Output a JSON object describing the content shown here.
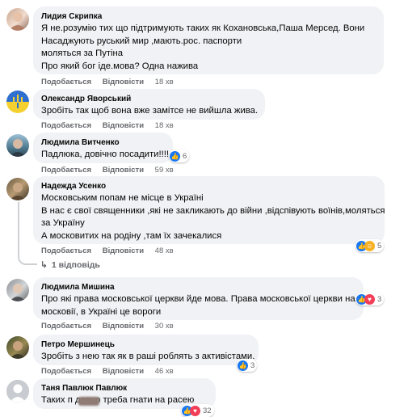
{
  "ui": {
    "like_label": "Подобається",
    "reply_label": "Відповісти",
    "replies_link": "1 відповідь",
    "colors": {
      "bubble": "#f0f2f5",
      "meta": "#65676b",
      "like": "#1877f2",
      "love": "#f33e58",
      "haha": "#f7b125"
    }
  },
  "comments": [
    {
      "author": "Лидия Скрипка",
      "lines": [
        "Я не.розумію тих що підтримують таких як Кохановська,Паша Мерсед. Вони",
        "Насаджують руський мир ,мають.рос. паспорти",
        "моляться за Путіна",
        "Про який бог іде.мова? Одна нажива"
      ],
      "time": "18 хв"
    },
    {
      "author": "Олександр Яворський",
      "lines": [
        "Зробіть так щоб вона вже замітсе не вийшла жива."
      ],
      "time": "18 хв"
    },
    {
      "author": "Людмила Витченко",
      "lines": [
        "Падлюка, довічно посадити!!!!"
      ],
      "time": "59 хв",
      "reactions": {
        "icons": [
          "like-icon"
        ],
        "count": "6"
      }
    },
    {
      "author": "Надежда Усенко",
      "lines": [
        "Московським попам не місце в Україні",
        "В нас є свої священники ,які не закликають до війни ,відспівують воїнів,моляться",
        "за Україну",
        "А московитих на родіну ,там їх зачекалися"
      ],
      "time": "48 хв",
      "reactions": {
        "icons": [
          "like-icon",
          "haha-icon"
        ],
        "count": "5"
      }
    },
    {
      "author": "Людмила Мишина",
      "lines": [
        "Про які права московської церкви йде мова. Права московської церкви на",
        "московії, в Україні це вороги"
      ],
      "time": "30 хв",
      "reactions": {
        "icons": [
          "like-icon",
          "love-icon"
        ],
        "count": "3"
      }
    },
    {
      "author": "Петро Мершинець",
      "lines": [
        "Зробіть з нею так як в раші роблять з активістами."
      ],
      "time": "46 хв",
      "reactions": {
        "icons": [
          "like-icon"
        ],
        "count": "3"
      }
    },
    {
      "author": "Таня Павлюк Павлюк",
      "lines": [
        "Таких п     давно треба гнати на расею"
      ],
      "time": "",
      "reactions": {
        "icons": [
          "like-icon",
          "love-icon"
        ],
        "count": "32"
      }
    }
  ]
}
